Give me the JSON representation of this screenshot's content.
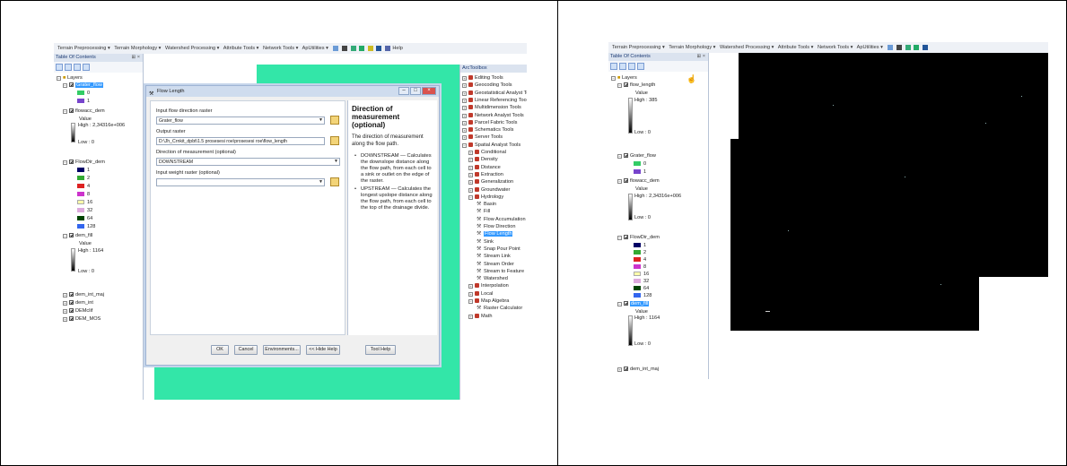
{
  "toolbar_items": [
    "Terrain Preprocessing ▾",
    "Terrain Morphology ▾",
    "Watershed Processing ▾",
    "Attribute Tools ▾",
    "Network Tools ▾",
    "ApUtilities ▾"
  ],
  "left": {
    "toolbar_help": "Help",
    "toc_title": "Table Of Contents",
    "layers_label": "Layers",
    "layers": {
      "grater_flow": "Grater_flow",
      "grater_vals": [
        "0",
        "1"
      ],
      "flowacc": "flowacc_dem",
      "value": "Value",
      "flowacc_high": "High : 2,34316e+006",
      "low0": "Low : 0",
      "flowdir": "FlowDir_dem",
      "flowdir_vals": [
        "1",
        "2",
        "4",
        "8",
        "16",
        "32",
        "64",
        "128"
      ],
      "demfill": "dem_fill",
      "demfill_high": "High : 1164",
      "others": [
        "dem_int_maj",
        "dem_int",
        "DEMclif",
        "DEM_MOS"
      ]
    },
    "dialog": {
      "title": "Flow Length",
      "input_label": "Input flow direction raster",
      "input_value": "Grater_flow",
      "output_label": "Output raster",
      "output_value": "D:\\Jh_Crnkit_dpbt\\1.5 prosesesi roe\\prosesesi roe\\flow_length",
      "direction_label": "Direction of measurement (optional)",
      "direction_value": "DOWNSTREAM",
      "weight_label": "Input weight raster (optional)",
      "buttons": {
        "ok": "OK",
        "cancel": "Cancel",
        "env": "Environments...",
        "hide": "<< Hide Help",
        "toolhelp": "Tool Help"
      }
    },
    "help": {
      "heading": "Direction of measurement (optional)",
      "intro": "The direction of measurement along the flow path.",
      "items": [
        "DOWNSTREAM — Calculates the downslope distance along the flow path, from each cell to a sink or outlet on the edge of the raster.",
        "UPSTREAM — Calculates the longest upslope distance along the flow path, from each cell to the top of the drainage divide."
      ]
    },
    "arctoolbox": {
      "title": "ArcToolbox",
      "toolsets": [
        "Editing Tools",
        "Geocoding Tools",
        "Geostatistical Analyst Tools",
        "Linear Referencing Tools",
        "Multidimension Tools",
        "Network Analyst Tools",
        "Parcel Fabric Tools",
        "Schematics Tools",
        "Server Tools",
        "Spatial Analyst Tools"
      ],
      "spatial": [
        "Conditional",
        "Density",
        "Distance",
        "Extraction",
        "Generalization",
        "Groundwater",
        "Hydrology"
      ],
      "hydrology": [
        "Basin",
        "Fill",
        "Flow Accumulation",
        "Flow Direction",
        "Flow Length",
        "Sink",
        "Snap Pour Point",
        "Stream Link",
        "Stream Order",
        "Stream to Feature",
        "Watershed"
      ],
      "after": [
        "Interpolation",
        "Local",
        "Map Algebra"
      ],
      "map_algebra": [
        "Raster Calculator"
      ],
      "math": "Math"
    }
  },
  "right": {
    "toc_title": "Table Of Contents",
    "layers_label": "Layers",
    "flow_length": "flow_length",
    "value": "Value",
    "flow_length_high": "High : 385",
    "low0": "Low : 0",
    "grater_flow": "Grater_flow",
    "grater_vals": [
      "0",
      "1"
    ],
    "flowacc": "flowacc_dem",
    "flowacc_high": "High : 2,34316e+006",
    "flowdir": "FlowDir_dem",
    "flowdir_vals": [
      "1",
      "2",
      "4",
      "8",
      "16",
      "32",
      "64",
      "128"
    ],
    "demfill": "dem_fill",
    "demfill_high": "High : 1164",
    "last": "dem_int_maj"
  },
  "colors": {
    "grater": [
      "#33cc66",
      "#7744cc"
    ],
    "flowdir": [
      "#000066",
      "#33aa33",
      "#dd2222",
      "#cc33cc",
      "#ffffaa",
      "#ddaadd",
      "#004400",
      "#3366ee"
    ],
    "green_map": "#33e6a8"
  }
}
